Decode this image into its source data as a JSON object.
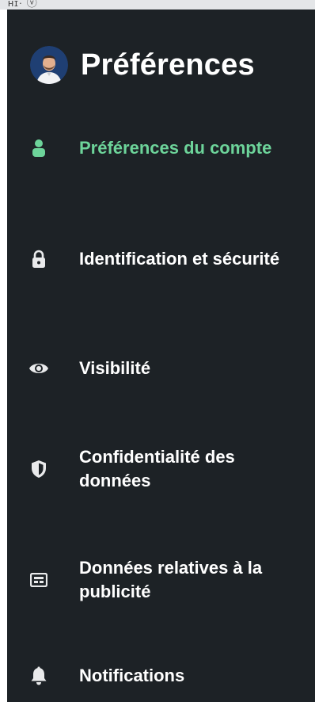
{
  "topbar": {
    "fragment": "ʜɪ· ⓥ"
  },
  "header": {
    "title": "Préférences"
  },
  "nav": {
    "items": [
      {
        "label": "Préférences du compte",
        "icon": "person-icon",
        "active": true
      },
      {
        "label": "Identification et sécurité",
        "icon": "lock-icon",
        "active": false
      },
      {
        "label": "Visibilité",
        "icon": "eye-icon",
        "active": false
      },
      {
        "label": "Confidentialité des données",
        "icon": "shield-icon",
        "active": false
      },
      {
        "label": "Données relatives à la publicité",
        "icon": "ad-card-icon",
        "active": false
      },
      {
        "label": "Notifications",
        "icon": "bell-icon",
        "active": false
      }
    ]
  },
  "colors": {
    "background": "#1d2226",
    "active": "#6dd49a",
    "text": "#ffffff",
    "icon": "#e9eaeb"
  }
}
